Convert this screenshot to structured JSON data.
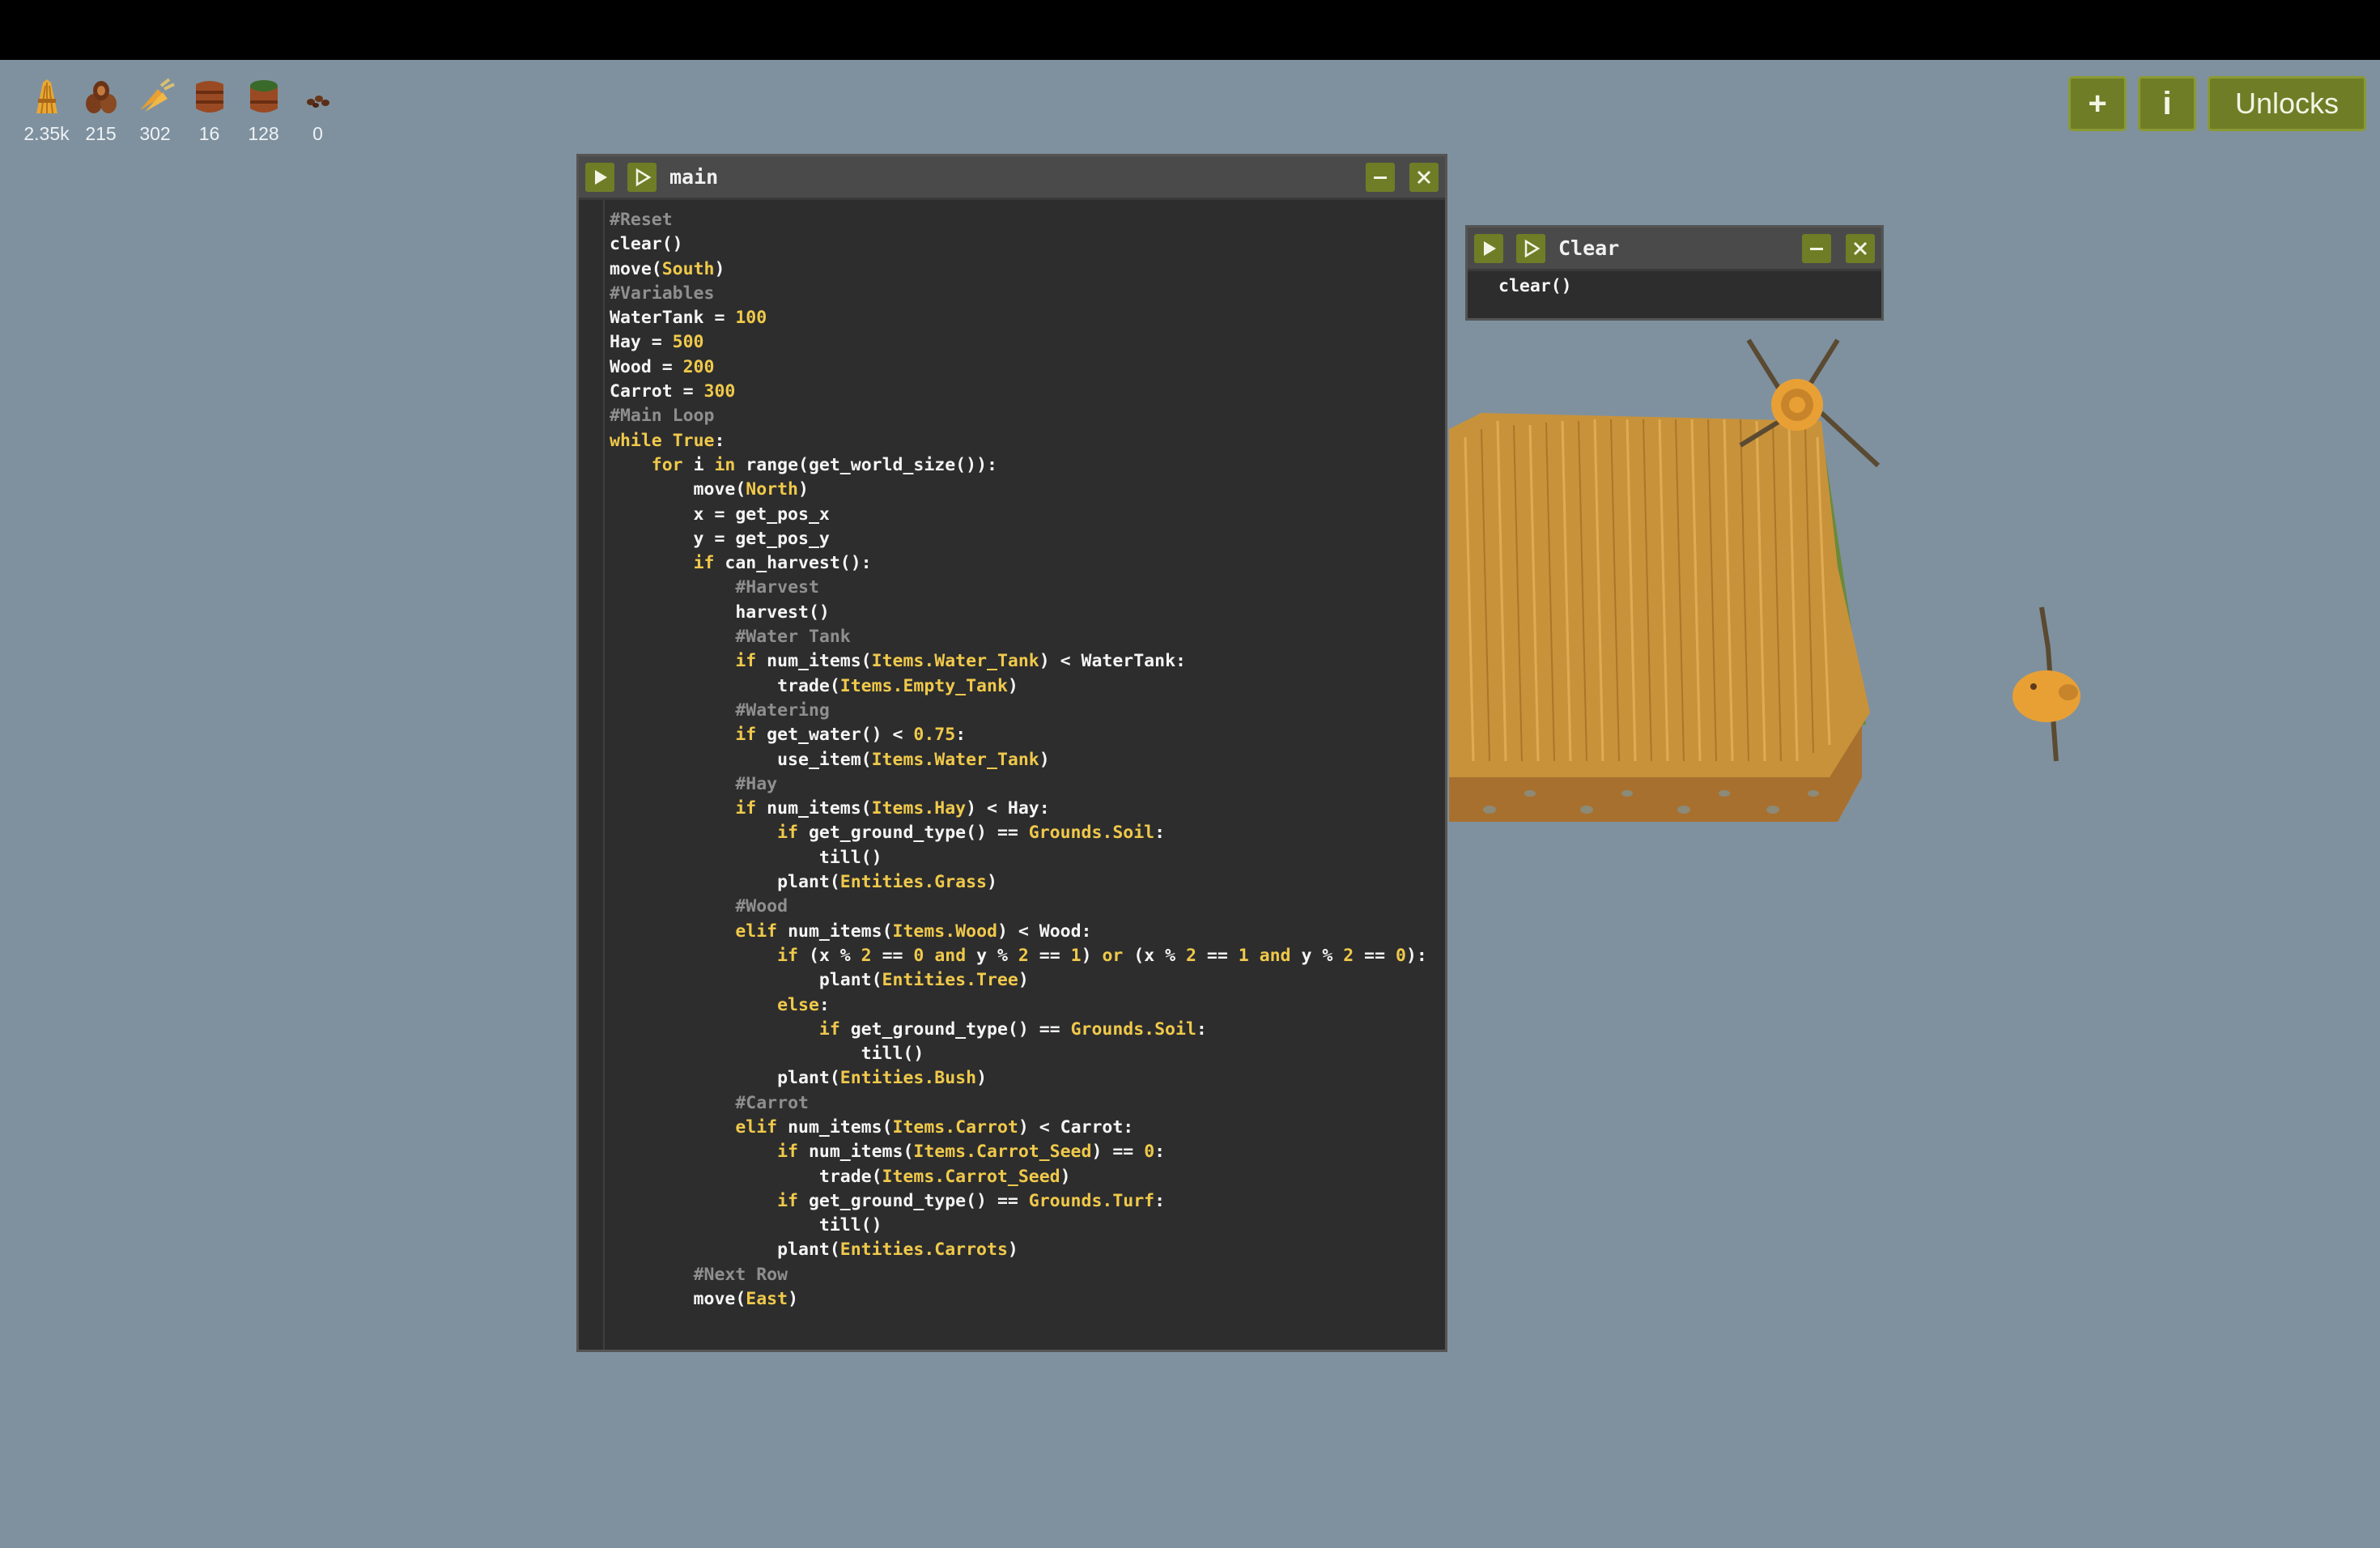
{
  "resources": [
    {
      "name": "hay-icon",
      "count": "2.35k"
    },
    {
      "name": "wood-icon",
      "count": "215"
    },
    {
      "name": "carrot-icon",
      "count": "302"
    },
    {
      "name": "water-tank-icon",
      "count": "16"
    },
    {
      "name": "empty-tank-icon",
      "count": "128"
    },
    {
      "name": "seeds-icon",
      "count": "0"
    }
  ],
  "top_right": {
    "add_label": "+",
    "info_label": "i",
    "unlocks_label": "Unlocks"
  },
  "main_window": {
    "title": "main",
    "lines": [
      [
        [
          "comment",
          "#Reset"
        ]
      ],
      [
        [
          "plain",
          "clear()"
        ]
      ],
      [
        [
          "plain",
          "move("
        ],
        [
          "ident",
          "South"
        ],
        [
          "plain",
          ")"
        ]
      ],
      [
        [
          "comment",
          "#Variables"
        ]
      ],
      [
        [
          "plain",
          "WaterTank = "
        ],
        [
          "number",
          "100"
        ]
      ],
      [
        [
          "plain",
          "Hay = "
        ],
        [
          "number",
          "500"
        ]
      ],
      [
        [
          "plain",
          "Wood = "
        ],
        [
          "number",
          "200"
        ]
      ],
      [
        [
          "plain",
          "Carrot = "
        ],
        [
          "number",
          "300"
        ]
      ],
      [
        [
          "comment",
          "#Main Loop"
        ]
      ],
      [
        [
          "keyword",
          "while"
        ],
        [
          "plain",
          " "
        ],
        [
          "keyword",
          "True"
        ],
        [
          "plain",
          ":"
        ]
      ],
      [
        [
          "plain",
          "    "
        ],
        [
          "keyword",
          "for"
        ],
        [
          "plain",
          " i "
        ],
        [
          "keyword",
          "in"
        ],
        [
          "plain",
          " range(get_world_size()):"
        ]
      ],
      [
        [
          "plain",
          "        move("
        ],
        [
          "ident",
          "North"
        ],
        [
          "plain",
          ")"
        ]
      ],
      [
        [
          "plain",
          "        x = get_pos_x"
        ]
      ],
      [
        [
          "plain",
          "        y = get_pos_y"
        ]
      ],
      [
        [
          "plain",
          "        "
        ],
        [
          "keyword",
          "if"
        ],
        [
          "plain",
          " can_harvest():"
        ]
      ],
      [
        [
          "plain",
          "            "
        ],
        [
          "comment",
          "#Harvest"
        ]
      ],
      [
        [
          "plain",
          "            harvest()"
        ]
      ],
      [
        [
          "plain",
          "            "
        ],
        [
          "comment",
          "#Water Tank"
        ]
      ],
      [
        [
          "plain",
          "            "
        ],
        [
          "keyword",
          "if"
        ],
        [
          "plain",
          " num_items("
        ],
        [
          "ident",
          "Items.Water_Tank"
        ],
        [
          "plain",
          ") < WaterTank:"
        ]
      ],
      [
        [
          "plain",
          "                trade("
        ],
        [
          "ident",
          "Items.Empty_Tank"
        ],
        [
          "plain",
          ")"
        ]
      ],
      [
        [
          "plain",
          "            "
        ],
        [
          "comment",
          "#Watering"
        ]
      ],
      [
        [
          "plain",
          "            "
        ],
        [
          "keyword",
          "if"
        ],
        [
          "plain",
          " get_water() < "
        ],
        [
          "number",
          "0.75"
        ],
        [
          "plain",
          ":"
        ]
      ],
      [
        [
          "plain",
          "                use_item("
        ],
        [
          "ident",
          "Items.Water_Tank"
        ],
        [
          "plain",
          ")"
        ]
      ],
      [
        [
          "plain",
          "            "
        ],
        [
          "comment",
          "#Hay"
        ]
      ],
      [
        [
          "plain",
          "            "
        ],
        [
          "keyword",
          "if"
        ],
        [
          "plain",
          " num_items("
        ],
        [
          "ident",
          "Items.Hay"
        ],
        [
          "plain",
          ") < Hay:"
        ]
      ],
      [
        [
          "plain",
          "                "
        ],
        [
          "keyword",
          "if"
        ],
        [
          "plain",
          " get_ground_type() == "
        ],
        [
          "ident",
          "Grounds.Soil"
        ],
        [
          "plain",
          ":"
        ]
      ],
      [
        [
          "plain",
          "                    till()"
        ]
      ],
      [
        [
          "plain",
          "                plant("
        ],
        [
          "ident",
          "Entities.Grass"
        ],
        [
          "plain",
          ")"
        ]
      ],
      [
        [
          "plain",
          "            "
        ],
        [
          "comment",
          "#Wood"
        ]
      ],
      [
        [
          "plain",
          "            "
        ],
        [
          "keyword",
          "elif"
        ],
        [
          "plain",
          " num_items("
        ],
        [
          "ident",
          "Items.Wood"
        ],
        [
          "plain",
          ") < Wood:"
        ]
      ],
      [
        [
          "plain",
          "                "
        ],
        [
          "keyword",
          "if"
        ],
        [
          "plain",
          " (x % "
        ],
        [
          "number",
          "2"
        ],
        [
          "plain",
          " == "
        ],
        [
          "number",
          "0"
        ],
        [
          "plain",
          " "
        ],
        [
          "keyword",
          "and"
        ],
        [
          "plain",
          " y % "
        ],
        [
          "number",
          "2"
        ],
        [
          "plain",
          " == "
        ],
        [
          "number",
          "1"
        ],
        [
          "plain",
          ") "
        ],
        [
          "keyword",
          "or"
        ],
        [
          "plain",
          " (x % "
        ],
        [
          "number",
          "2"
        ],
        [
          "plain",
          " == "
        ],
        [
          "number",
          "1"
        ],
        [
          "plain",
          " "
        ],
        [
          "keyword",
          "and"
        ],
        [
          "plain",
          " y % "
        ],
        [
          "number",
          "2"
        ],
        [
          "plain",
          " == "
        ],
        [
          "number",
          "0"
        ],
        [
          "plain",
          "):"
        ]
      ],
      [
        [
          "plain",
          "                    plant("
        ],
        [
          "ident",
          "Entities.Tree"
        ],
        [
          "plain",
          ")"
        ]
      ],
      [
        [
          "plain",
          "                "
        ],
        [
          "keyword",
          "else"
        ],
        [
          "plain",
          ":"
        ]
      ],
      [
        [
          "plain",
          "                    "
        ],
        [
          "keyword",
          "if"
        ],
        [
          "plain",
          " get_ground_type() == "
        ],
        [
          "ident",
          "Grounds.Soil"
        ],
        [
          "plain",
          ":"
        ]
      ],
      [
        [
          "plain",
          "                        till()"
        ]
      ],
      [
        [
          "plain",
          "                plant("
        ],
        [
          "ident",
          "Entities.Bush"
        ],
        [
          "plain",
          ")"
        ]
      ],
      [
        [
          "plain",
          "            "
        ],
        [
          "comment",
          "#Carrot"
        ]
      ],
      [
        [
          "plain",
          "            "
        ],
        [
          "keyword",
          "elif"
        ],
        [
          "plain",
          " num_items("
        ],
        [
          "ident",
          "Items.Carrot"
        ],
        [
          "plain",
          ") < Carrot:"
        ]
      ],
      [
        [
          "plain",
          "                "
        ],
        [
          "keyword",
          "if"
        ],
        [
          "plain",
          " num_items("
        ],
        [
          "ident",
          "Items.Carrot_Seed"
        ],
        [
          "plain",
          ") == "
        ],
        [
          "number",
          "0"
        ],
        [
          "plain",
          ":"
        ]
      ],
      [
        [
          "plain",
          "                    trade("
        ],
        [
          "ident",
          "Items.Carrot_Seed"
        ],
        [
          "plain",
          ")"
        ]
      ],
      [
        [
          "plain",
          "                "
        ],
        [
          "keyword",
          "if"
        ],
        [
          "plain",
          " get_ground_type() == "
        ],
        [
          "ident",
          "Grounds.Turf"
        ],
        [
          "plain",
          ":"
        ]
      ],
      [
        [
          "plain",
          "                    till()"
        ]
      ],
      [
        [
          "plain",
          "                plant("
        ],
        [
          "ident",
          "Entities.Carrots"
        ],
        [
          "plain",
          ")"
        ]
      ],
      [
        [
          "plain",
          "        "
        ],
        [
          "comment",
          "#Next Row"
        ]
      ],
      [
        [
          "plain",
          "        move("
        ],
        [
          "ident",
          "East"
        ],
        [
          "plain",
          ")"
        ]
      ]
    ]
  },
  "clear_window": {
    "title": "Clear",
    "lines": [
      [
        [
          "plain",
          "clear()"
        ]
      ]
    ]
  },
  "colors": {
    "background": "#7f919f",
    "button": "#6f7d26",
    "editor_bg": "#2d2d2d",
    "keyword": "#f0c94b",
    "comment": "#8f8f8f"
  }
}
